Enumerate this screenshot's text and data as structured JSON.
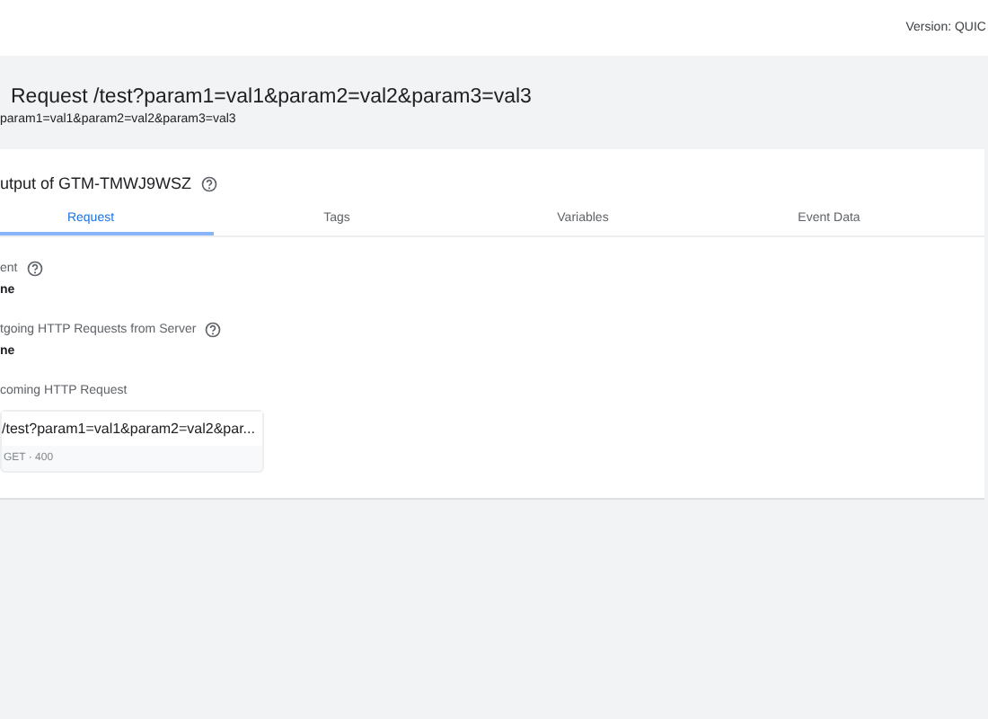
{
  "top_bar": {
    "version": "Version: QUIC"
  },
  "header": {
    "title": "Request /test?param1=val1&param2=val2&param3=val3",
    "subtitle": "param1=val1&param2=val2&param3=val3"
  },
  "output": {
    "title": "utput of GTM-TMWJ9WSZ",
    "tabs": [
      {
        "label": "Request",
        "selected": true
      },
      {
        "label": "Tags",
        "selected": false
      },
      {
        "label": "Variables",
        "selected": false
      },
      {
        "label": "Event Data",
        "selected": false
      }
    ],
    "sections": [
      {
        "label": "ent",
        "help": true,
        "value": "ne"
      },
      {
        "label": "tgoing HTTP Requests from Server",
        "help": true,
        "value": "ne"
      },
      {
        "label": "coming HTTP Request",
        "help": false,
        "request": {
          "path": "/test?param1=val1&param2=val2&par...",
          "meta": "GET · 400"
        }
      }
    ]
  }
}
